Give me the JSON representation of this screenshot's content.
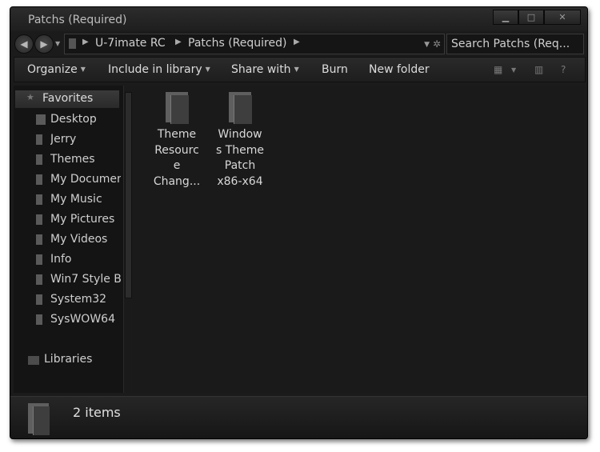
{
  "window": {
    "title": "Patchs (Required)"
  },
  "address": {
    "crumbs": [
      "U-7imate RC",
      "Patchs (Required)"
    ]
  },
  "search": {
    "text": "Search Patchs (Req..."
  },
  "toolbar": {
    "organize": "Organize",
    "include_in_library": "Include in library",
    "share_with": "Share with",
    "burn": "Burn",
    "new_folder": "New folder"
  },
  "navpane": {
    "favorites_label": "Favorites",
    "items": [
      {
        "label": "Desktop"
      },
      {
        "label": "Jerry"
      },
      {
        "label": "Themes"
      },
      {
        "label": "My Documents"
      },
      {
        "label": "My Music"
      },
      {
        "label": "My Pictures"
      },
      {
        "label": "My Videos"
      },
      {
        "label": "Info"
      },
      {
        "label": "Win7 Style B"
      },
      {
        "label": "System32"
      },
      {
        "label": "SysWOW64"
      }
    ],
    "libraries_label": "Libraries"
  },
  "files": [
    {
      "lines": [
        "Theme",
        "Resourc",
        "e",
        "Chang..."
      ]
    },
    {
      "lines": [
        "Window",
        "s Theme",
        "Patch",
        "x86-x64"
      ]
    }
  ],
  "status": {
    "text": "2 items"
  },
  "colors": {
    "window_bg": "#1b1b1b",
    "text": "#d6d6d6"
  },
  "icons": {
    "back": "back-arrow-icon",
    "forward": "forward-arrow-icon",
    "folder": "folder-icon",
    "star": "star-icon",
    "library": "library-icon",
    "views": "views-icon",
    "preview": "preview-pane-icon",
    "help": "help-icon"
  }
}
